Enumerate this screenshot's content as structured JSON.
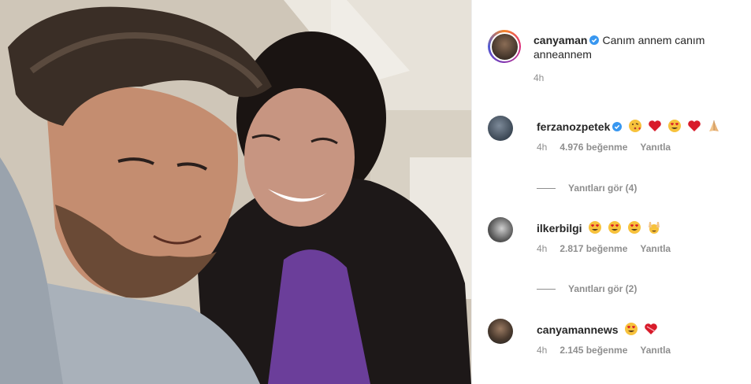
{
  "post": {
    "username": "canyaman",
    "caption": "Canım annem canım anneannem",
    "time": "4h"
  },
  "comments": [
    {
      "username": "ferzanozpetek",
      "emojis": [
        "face-blowing-kiss",
        "red-heart",
        "heart-eyes",
        "red-heart",
        "folded-hands"
      ],
      "time": "4h",
      "likes": "4.976 beğenme",
      "reply": "Yanıtla",
      "view_replies": "Yanıtları gör (4)"
    },
    {
      "username": "ilkerbilgi",
      "emojis": [
        "heart-eyes",
        "heart-eyes",
        "heart-eyes",
        "raising-hands"
      ],
      "time": "4h",
      "likes": "2.817 beğenme",
      "reply": "Yanıtla",
      "view_replies": "Yanıtları gör (2)"
    },
    {
      "username": "canyamannews",
      "emojis": [
        "heart-eyes",
        "heart-with-ribbon"
      ],
      "time": "4h",
      "likes": "2.145 beğenme",
      "reply": "Yanıtla"
    }
  ],
  "colors": {
    "verified": "#3897f0",
    "muted": "#8e8e8e",
    "text": "#262626"
  }
}
